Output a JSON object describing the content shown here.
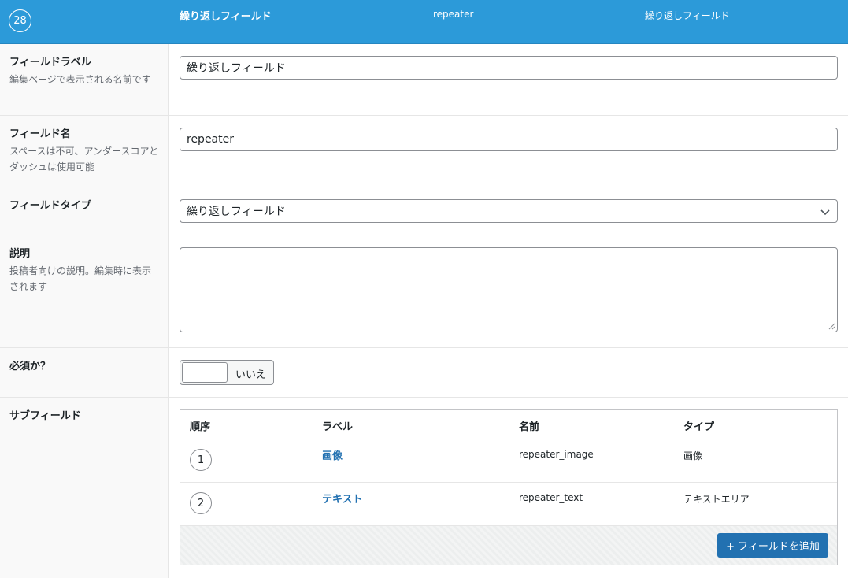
{
  "header": {
    "order": "28",
    "label": "繰り返しフィールド",
    "name": "repeater",
    "type": "繰り返しフィールド"
  },
  "fields": {
    "label": {
      "title": "フィールドラベル",
      "desc": "編集ページで表示される名前です",
      "value": "繰り返しフィールド"
    },
    "name": {
      "title": "フィールド名",
      "desc": "スペースは不可、アンダースコアとダッシュは使用可能",
      "value": "repeater"
    },
    "type": {
      "title": "フィールドタイプ",
      "value": "繰り返しフィールド"
    },
    "description": {
      "title": "説明",
      "desc": "投稿者向けの説明。編集時に表示されます",
      "value": ""
    },
    "required": {
      "title": "必須か？",
      "toggle_label": "いいえ"
    },
    "subfields": {
      "title": "サブフィールド",
      "columns": [
        "順序",
        "ラベル",
        "名前",
        "タイプ"
      ],
      "rows": [
        {
          "order": "1",
          "label": "画像",
          "name": "repeater_image",
          "type": "画像"
        },
        {
          "order": "2",
          "label": "テキスト",
          "name": "repeater_text",
          "type": "テキストエリア"
        }
      ],
      "add_button": "+ フィールドを追加"
    }
  },
  "colors": {
    "header_bg": "#2c9ad9",
    "accent": "#2271b1"
  }
}
